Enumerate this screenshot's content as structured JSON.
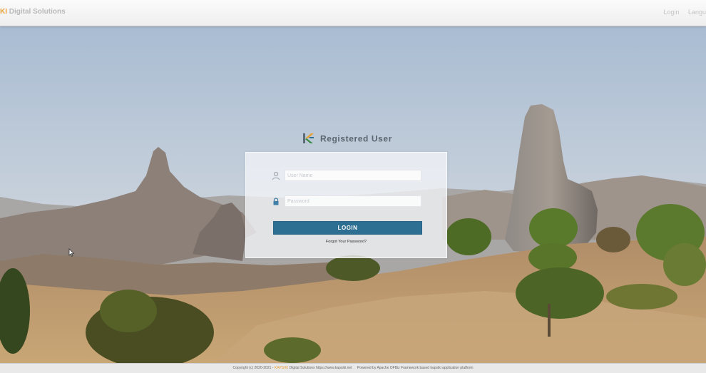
{
  "header": {
    "brand_prefix": "KI",
    "brand_name": "Digital Solutions",
    "nav": {
      "login": "Login",
      "language": "Langu"
    }
  },
  "login": {
    "title": "Registered User",
    "username_placeholder": "User Name",
    "password_placeholder": "Password",
    "login_button": "LOGIN",
    "forgot_link": "Forgot Your Password?"
  },
  "footer": {
    "copyright_prefix": "Copyright (c) 2020-2021 - ",
    "company": "KAPSIKI",
    "copyright_suffix": " Digital Solutions https://www.kapsiki.net",
    "powered_by": "Powered by Apache OFBiz Framework based kapsiki application platform"
  },
  "colors": {
    "brand_accent": "#e8a23a",
    "login_button": "#2d6f93",
    "card_background": "#f2f4f7"
  },
  "icons": {
    "username": "user-icon",
    "password": "lock-icon",
    "title_logo": "kapsiki-logo-icon"
  }
}
